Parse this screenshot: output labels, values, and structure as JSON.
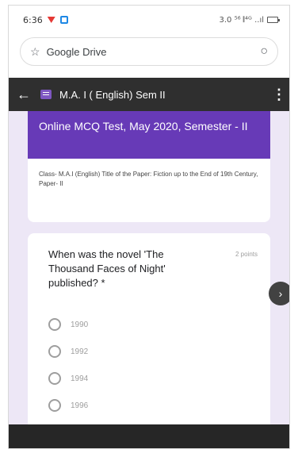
{
  "status_bar": {
    "time": "6:36",
    "right_text": "3.0 ⁵⁶ 𝄃⁴ᴳ ..ıl"
  },
  "url_bar": {
    "icon_star": "star-icon",
    "url": "Google Drive",
    "icon_reload": "reload-icon"
  },
  "app_bar": {
    "title": "M.A. I ( English) Sem II",
    "back_icon": "back-arrow-icon",
    "menu_icon": "overflow-menu-icon"
  },
  "form_header": {
    "title": "Online MCQ Test, May 2020, Semester - II",
    "description": "Class- M.A.I (English)    Title of the Paper: Fiction up to the End of 19th Century,    Paper- II",
    "color": "#673ab7"
  },
  "question": {
    "text": "When was the novel 'The Thousand Faces of Night' published? *",
    "points": "2 points",
    "options": [
      "1990",
      "1992",
      "1994",
      "1996"
    ]
  },
  "colors": {
    "background": "#ede7f6",
    "appbar": "#2f2f2f"
  }
}
